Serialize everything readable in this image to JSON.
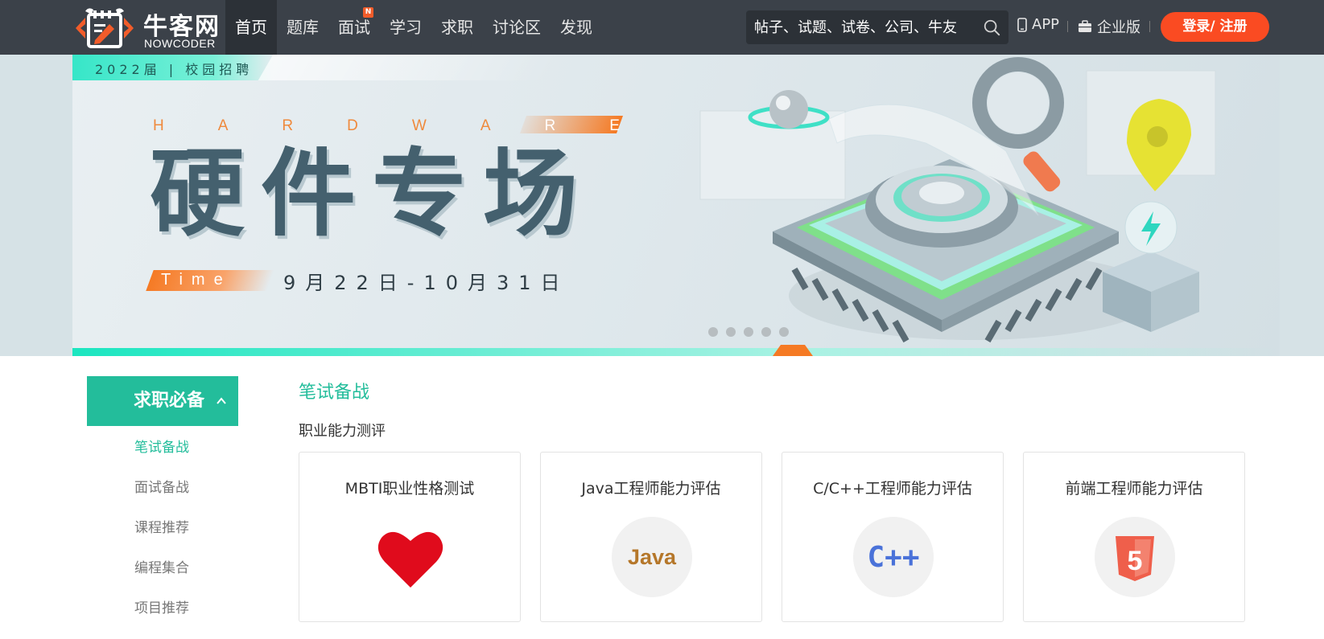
{
  "header": {
    "logo_cn": "牛客网",
    "logo_en": "NOWCODER",
    "nav": [
      {
        "label": "首页",
        "active": true
      },
      {
        "label": "题库"
      },
      {
        "label": "面试",
        "badge": "N"
      },
      {
        "label": "学习"
      },
      {
        "label": "求职"
      },
      {
        "label": "讨论区"
      },
      {
        "label": "发现"
      }
    ],
    "search_placeholder": "帖子、试题、试卷、公司、牛友",
    "app_label": "APP",
    "enterprise_label": "企业版",
    "login_label": "登录/ 注册"
  },
  "banner": {
    "tag": "2022届 | 校园招聘",
    "hardware": [
      "H",
      "A",
      "R",
      "D",
      "W",
      "A",
      "R",
      "E"
    ],
    "title": "硬件专场",
    "time_label": "Time",
    "date": "9月22日-10月31日",
    "slide_count": 5
  },
  "sidebar": {
    "header": "求职必备",
    "items": [
      {
        "label": "笔试备战",
        "active": true
      },
      {
        "label": "面试备战"
      },
      {
        "label": "课程推荐"
      },
      {
        "label": "编程集合"
      },
      {
        "label": "项目推荐"
      }
    ]
  },
  "main": {
    "section_title": "笔试备战",
    "subsection_title": "职业能力测评",
    "cards": [
      {
        "title": "MBTI职业性格测试",
        "icon": "heart-icon"
      },
      {
        "title": "Java工程师能力评估",
        "icon": "java-icon",
        "icon_text": "Java"
      },
      {
        "title": "C/C++工程师能力评估",
        "icon": "cpp-icon",
        "icon_text": "C++"
      },
      {
        "title": "前端工程师能力评估",
        "icon": "html5-icon",
        "icon_text": "5"
      }
    ]
  },
  "colors": {
    "header_bg": "#3b4149",
    "accent_green": "#23bd9b",
    "login_orange": "#fa4b22",
    "heart_red": "#e00b1c",
    "java_brown": "#b5772a",
    "cpp_blue": "#4a72d9",
    "html5_red": "#ef5f4b"
  }
}
